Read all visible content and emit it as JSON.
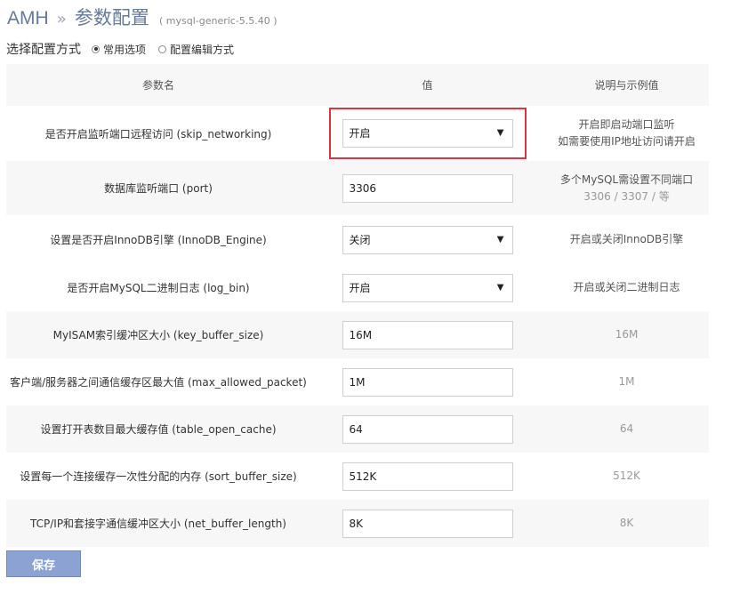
{
  "header": {
    "brand": "AMH",
    "separator": "»",
    "title": "参数配置",
    "subtitle": "( mysql-generic-5.5.40 )"
  },
  "mode": {
    "label": "选择配置方式",
    "options": [
      {
        "label": "常用选项",
        "checked": true
      },
      {
        "label": "配置编辑方式",
        "checked": false
      }
    ]
  },
  "table": {
    "headers": [
      "参数名",
      "值",
      "说明与示例值"
    ],
    "rows": [
      {
        "name": "是否开启监听端口远程访问 (skip_networking)",
        "type": "select",
        "value": "开启",
        "desc1": "开启即启动端口监听",
        "desc2": "如需要使用IP地址访问请开启"
      },
      {
        "name": "数据库监听端口 (port)",
        "type": "input",
        "value": "3306",
        "desc1": "多个MySQL需设置不同端口",
        "desc2": "3306 / 3307 / 等"
      },
      {
        "name": "设置是否开启InnoDB引擎 (InnoDB_Engine)",
        "type": "select",
        "value": "关闭",
        "desc1": "开启或关闭InnoDB引擎"
      },
      {
        "name": "是否开启MySQL二进制日志 (log_bin)",
        "type": "select",
        "value": "开启",
        "desc1": "开启或关闭二进制日志"
      },
      {
        "name": "MyISAM索引缓冲区大小 (key_buffer_size)",
        "type": "input",
        "value": "16M",
        "desc1": "16M"
      },
      {
        "name": "客户端/服务器之间通信缓存区最大值 (max_allowed_packet)",
        "type": "input",
        "value": "1M",
        "desc1": "1M"
      },
      {
        "name": "设置打开表数目最大缓存值 (table_open_cache)",
        "type": "input",
        "value": "64",
        "desc1": "64"
      },
      {
        "name": "设置每一个连接缓存一次性分配的内存 (sort_buffer_size)",
        "type": "input",
        "value": "512K",
        "desc1": "512K"
      },
      {
        "name": "TCP/IP和套接字通信缓冲区大小 (net_buffer_length)",
        "type": "input",
        "value": "8K",
        "desc1": "8K"
      }
    ]
  },
  "actions": {
    "save_label": "保存"
  },
  "icons": {
    "select_arrow": "▼"
  },
  "colors": {
    "highlight": "#d9363e",
    "button": "#8ca2d2",
    "title": "#667a99"
  }
}
